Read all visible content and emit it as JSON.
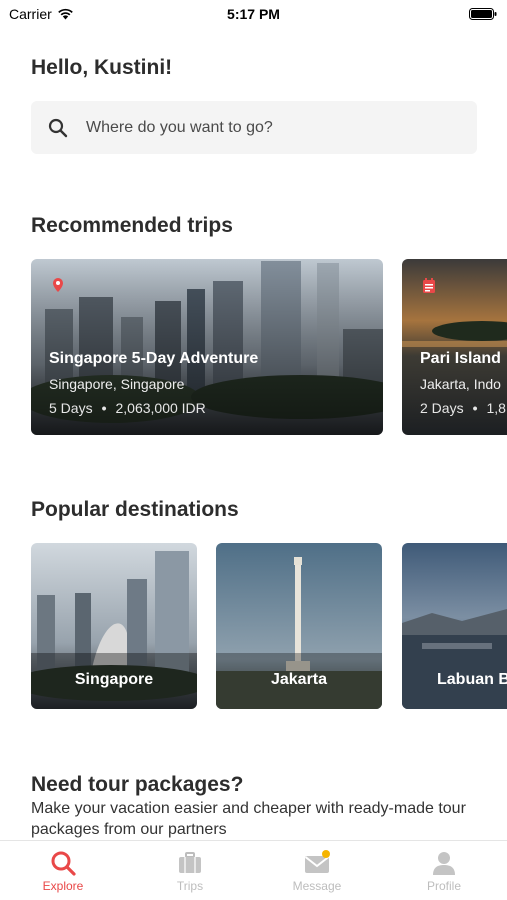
{
  "status_bar": {
    "carrier": "Carrier",
    "time": "5:17 PM"
  },
  "greeting": "Hello, Kustini!",
  "search": {
    "placeholder": "Where do you want to go?"
  },
  "recommended": {
    "title": "Recommended trips",
    "trips": [
      {
        "title": "Singapore 5-Day Adventure",
        "location": "Singapore, Singapore",
        "duration": "5 Days",
        "price": "2,063,000 IDR"
      },
      {
        "title": "Pari Island",
        "location": "Jakarta, Indo",
        "duration": "2 Days",
        "price": "1,8"
      }
    ]
  },
  "popular": {
    "title": "Popular destinations",
    "destinations": [
      {
        "name": "Singapore"
      },
      {
        "name": "Jakarta"
      },
      {
        "name": "Labuan B"
      }
    ]
  },
  "packages": {
    "title": "Need tour packages?",
    "description": "Make your vacation easier and cheaper with ready-made tour packages from our partners"
  },
  "tabs": [
    {
      "label": "Explore",
      "icon": "search-icon",
      "active": true
    },
    {
      "label": "Trips",
      "icon": "suitcase-icon",
      "active": false
    },
    {
      "label": "Message",
      "icon": "envelope-icon",
      "active": false
    },
    {
      "label": "Profile",
      "icon": "person-icon",
      "active": false
    }
  ],
  "colors": {
    "accent": "#e94848",
    "badge": "#f5b400",
    "inactive": "#bdbdbd"
  }
}
